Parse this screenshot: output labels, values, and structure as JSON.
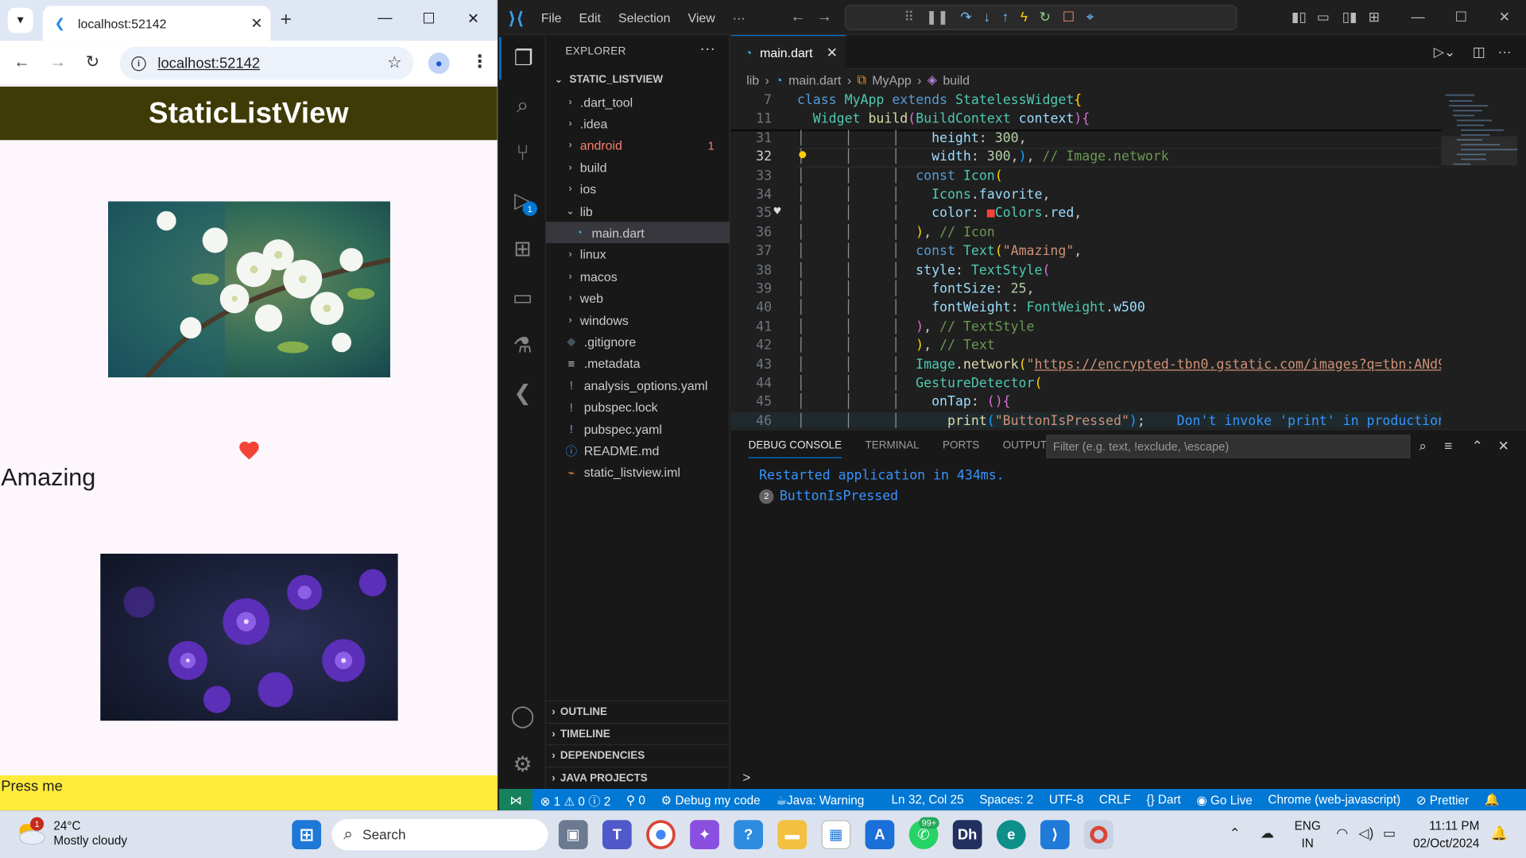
{
  "chrome": {
    "tab_title": "localhost:52142",
    "url": "localhost:52142",
    "app": {
      "appbar_title": "StaticListView",
      "amazing_text": "Amazing",
      "button_text": "Press me",
      "colors": {
        "appbar": "#3f3b06",
        "button": "#ffeb3b",
        "heart": "#f44336"
      }
    }
  },
  "vscode": {
    "menu": [
      "File",
      "Edit",
      "Selection",
      "View",
      "···"
    ],
    "explorer": {
      "title": "EXPLORER",
      "root": "STATIC_LISTVIEW",
      "items": [
        {
          "label": ".dart_tool",
          "kind": "folder"
        },
        {
          "label": ".idea",
          "kind": "folder"
        },
        {
          "label": "android",
          "kind": "folder",
          "count": "1"
        },
        {
          "label": "build",
          "kind": "folder"
        },
        {
          "label": "ios",
          "kind": "folder"
        },
        {
          "label": "lib",
          "kind": "folder-open"
        },
        {
          "label": "main.dart",
          "kind": "dart"
        },
        {
          "label": "linux",
          "kind": "folder"
        },
        {
          "label": "macos",
          "kind": "folder"
        },
        {
          "label": "web",
          "kind": "folder"
        },
        {
          "label": "windows",
          "kind": "folder"
        },
        {
          "label": ".gitignore",
          "kind": "git"
        },
        {
          "label": ".metadata",
          "kind": "text"
        },
        {
          "label": "analysis_options.yaml",
          "kind": "yaml"
        },
        {
          "label": "pubspec.lock",
          "kind": "yaml"
        },
        {
          "label": "pubspec.yaml",
          "kind": "yaml"
        },
        {
          "label": "README.md",
          "kind": "info"
        },
        {
          "label": "static_listview.iml",
          "kind": "rss"
        }
      ],
      "sections": [
        "OUTLINE",
        "TIMELINE",
        "DEPENDENCIES",
        "JAVA PROJECTS"
      ]
    },
    "editor": {
      "tab": "main.dart",
      "breadcrumb": [
        "lib",
        "main.dart",
        "MyApp",
        "build"
      ],
      "line_numbers": [
        "7",
        "11",
        "31",
        "32",
        "33",
        "34",
        "35",
        "36",
        "37",
        "38",
        "39",
        "40",
        "41",
        "42",
        "43",
        "44",
        "45",
        "46"
      ],
      "current_line": "32"
    },
    "panel": {
      "tabs": [
        "DEBUG CONSOLE",
        "TERMINAL",
        "PORTS",
        "OUTPUT"
      ],
      "filter_placeholder": "Filter (e.g. text, !exclude, \\escape)",
      "lines": [
        "Restarted application in 434ms.",
        "ButtonIsPressed"
      ],
      "count": "2",
      "prompt": ">"
    },
    "status": {
      "errors": "1",
      "warnings": "0",
      "infos": "2",
      "ports": "0",
      "debug": "Debug my code",
      "java": "Java: Warning",
      "position": "Ln 32, Col 25",
      "spaces": "Spaces: 2",
      "encoding": "UTF-8",
      "eol": "CRLF",
      "language": "Dart",
      "golive": "Go Live",
      "device": "Chrome (web-javascript)",
      "prettier": "Prettier"
    }
  },
  "taskbar": {
    "temp": "24°C",
    "weather": "Mostly cloudy",
    "weather_badge": "1",
    "search": "Search",
    "whatsapp_badge": "99+",
    "lang": "ENG",
    "region": "IN",
    "time": "11:11 PM",
    "date": "02/Oct/2024"
  }
}
